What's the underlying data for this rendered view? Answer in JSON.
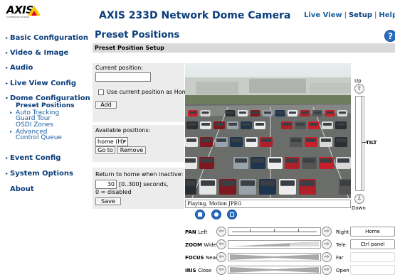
{
  "header": {
    "logo_text": "AXIS",
    "logo_subtext": "COMMUNICATIONS",
    "product_title": "AXIS 233D Network Dome Camera",
    "links": [
      "Live View",
      "Setup",
      "Help"
    ]
  },
  "nav": {
    "items": [
      {
        "label": "Basic Configuration"
      },
      {
        "label": "Video & Image"
      },
      {
        "label": "Audio"
      },
      {
        "label": "Live View Config"
      },
      {
        "label": "Dome Configuration"
      },
      {
        "label": "Event Config"
      },
      {
        "label": "System Options"
      },
      {
        "label": "About"
      }
    ],
    "dome_sub": {
      "preset_positions": "Preset Positions",
      "auto_tracking": "Auto Tracking",
      "guard_tour": "Guard Tour",
      "osdi_zones": "OSDI Zones",
      "advanced": "Advanced",
      "control_queue": "Control Queue"
    }
  },
  "page": {
    "title": "Preset Positions",
    "help_glyph": "?",
    "section_title": "Preset Position Setup"
  },
  "current_position": {
    "label": "Current position:",
    "value": "",
    "home_checkbox_label": "Use current position as Home",
    "home_checked": false,
    "add_button": "Add"
  },
  "available_positions": {
    "label": "Available positions:",
    "selected": "home (H)",
    "goto_button": "Go to",
    "remove_button": "Remove"
  },
  "return_home": {
    "label": "Return to home when inactive:",
    "value": "30",
    "range_text": "[0..300] seconds,",
    "disabled_text": "0 = disabled",
    "save_button": "Save"
  },
  "video": {
    "status_text": "Playing, Motion JPEG"
  },
  "tilt": {
    "up_label": "Up",
    "down_label": "Down",
    "name": "TILT"
  },
  "controls": {
    "pan": {
      "name": "PAN",
      "low": "Left",
      "high": "Right"
    },
    "zoom": {
      "name": "ZOOM",
      "low": "Wide",
      "high": "Tele"
    },
    "focus": {
      "name": "FOCUS",
      "low": "Near",
      "high": "Far"
    },
    "iris": {
      "name": "IRIS",
      "low": "Close",
      "high": "Open"
    }
  },
  "side_buttons": {
    "home": "Home",
    "ctrl_panel": "Ctrl panel"
  },
  "colors": {
    "brand_blue": "#0a3d7a",
    "link_blue": "#1a5e9e",
    "icon_blue": "#2a6cc4",
    "panel_gray": "#ececec",
    "section_gray": "#d9d9d9"
  }
}
